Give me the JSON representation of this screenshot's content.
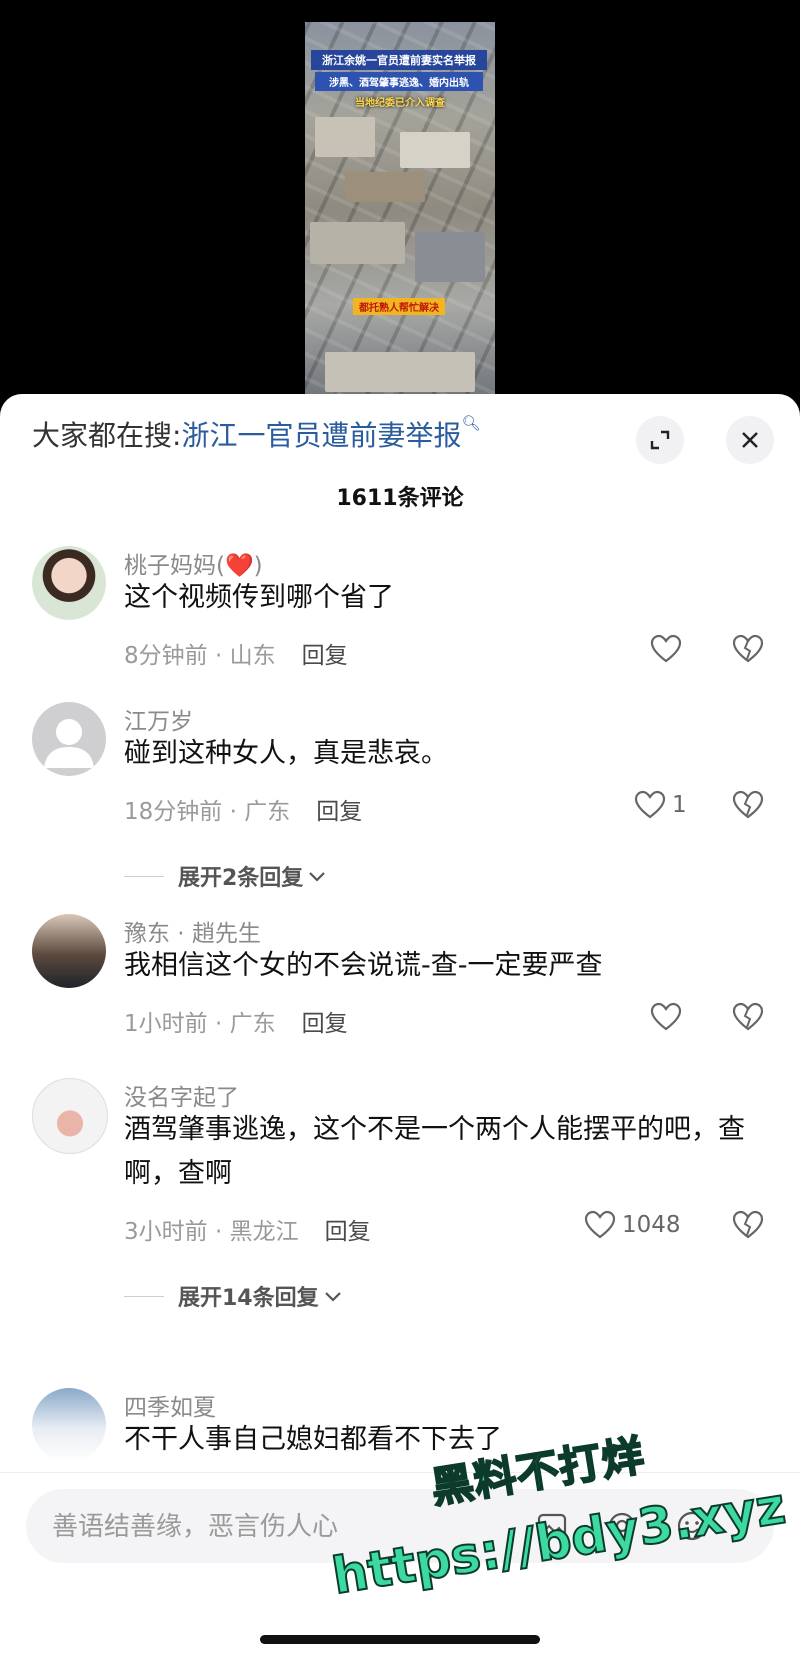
{
  "video": {
    "caption_1": "浙江余姚一官员遭前妻实名举报",
    "caption_2": "涉黑、酒驾肇事逃逸、婚内出轨",
    "caption_3": "当地纪委已介入调查",
    "caption_4": "都托熟人帮忙解决"
  },
  "header": {
    "search_prefix": "大家都在搜:",
    "search_link": "浙江一官员遭前妻举报",
    "comment_count": "1611条评论"
  },
  "comments": [
    {
      "username": "桃子妈妈(",
      "username_emoji": "❤️",
      "username_suffix": ")",
      "text": "这个视频传到哪个省了",
      "meta": "8分钟前 · 山东",
      "reply": "回复",
      "likes": ""
    },
    {
      "username": "江万岁",
      "text": "碰到这种女人，真是悲哀。",
      "meta": "18分钟前 · 广东",
      "reply": "回复",
      "likes": "1",
      "expand": "展开2条回复"
    },
    {
      "username": "豫东 · 趙先生",
      "text": "我相信这个女的不会说谎-查-一定要严查",
      "meta": "1小时前 · 广东",
      "reply": "回复",
      "likes": ""
    },
    {
      "username": "没名字起了",
      "text": "酒驾肇事逃逸，这个不是一个两个人能摆平的吧，查啊，查啊",
      "meta": "3小时前 · 黑龙江",
      "reply": "回复",
      "likes": "1048",
      "expand": "展开14条回复"
    },
    {
      "username": "四季如夏",
      "text": "不干人事自己媳妇都看不下去了"
    }
  ],
  "input": {
    "placeholder": "善语结善缘，恶言伤人心"
  },
  "watermark": {
    "line_1": "黑料不打烊",
    "line_2": "https://bdy3.xyz"
  },
  "colors": {
    "link": "#2b5c9e",
    "heart": "#e0252b",
    "watermark": "#3cd9a0"
  }
}
